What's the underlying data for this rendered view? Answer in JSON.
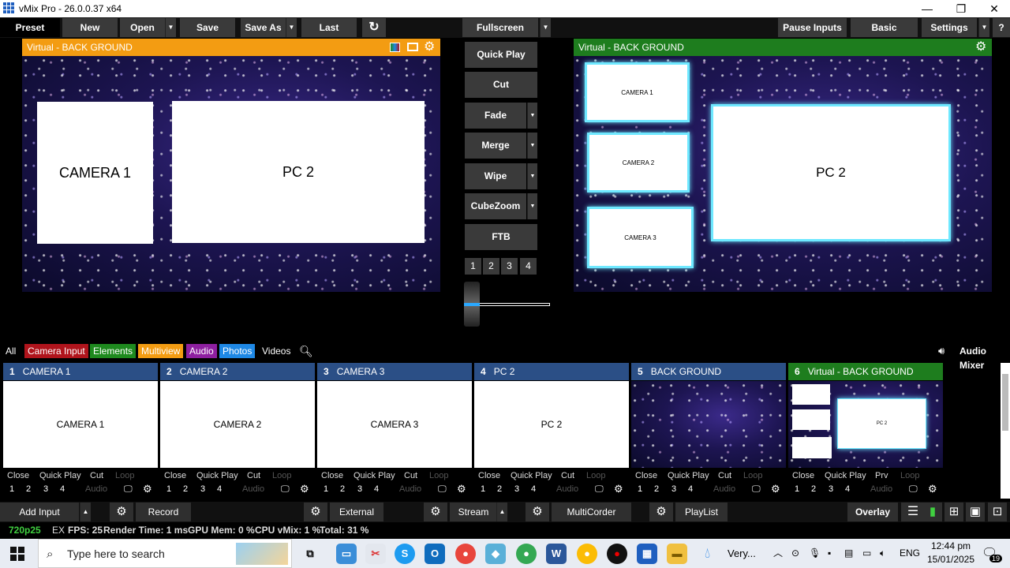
{
  "window": {
    "title": "vMix Pro - 26.0.0.37 x64",
    "minimize": "—",
    "maximize": "❐",
    "close": "✕"
  },
  "toolbar": {
    "preset": "Preset",
    "new": "New",
    "open": "Open",
    "save": "Save",
    "save_as": "Save As",
    "last": "Last",
    "refresh_icon": "refresh-icon",
    "fullscreen": "Fullscreen",
    "pause_inputs": "Pause Inputs",
    "basic": "Basic",
    "settings": "Settings",
    "help": "?"
  },
  "preview": {
    "title": "Virtual - BACK GROUND",
    "boxes": [
      "CAMERA 1",
      "PC 2"
    ],
    "header_color": "#f39c12"
  },
  "output": {
    "title": "Virtual - BACK GROUND",
    "boxes": [
      "CAMERA 1",
      "CAMERA 2",
      "CAMERA 3",
      "PC 2"
    ],
    "header_color": "#1e7d1e"
  },
  "transitions": {
    "quick_play": "Quick Play",
    "cut": "Cut",
    "fade": "Fade",
    "merge": "Merge",
    "wipe": "Wipe",
    "cubezoom": "CubeZoom",
    "ftb": "FTB",
    "numbers": [
      "1",
      "2",
      "3",
      "4"
    ]
  },
  "filters": {
    "all": "All",
    "camera_input": "Camera Input",
    "elements": "Elements",
    "multiview": "Multiview",
    "audio": "Audio",
    "photos": "Photos",
    "videos": "Videos",
    "audio_mixer": "Audio Mixer",
    "colors": {
      "camera_input": "#b0141c",
      "elements": "#1e8a1e",
      "multiview": "#f39c12",
      "audio": "#8e1fa0",
      "photos": "#1e88e5"
    }
  },
  "inputs": [
    {
      "num": "1",
      "name": "CAMERA 1",
      "thumb": "CAMERA 1",
      "cut": "Cut"
    },
    {
      "num": "2",
      "name": "CAMERA 2",
      "thumb": "CAMERA 2",
      "cut": "Cut"
    },
    {
      "num": "3",
      "name": "CAMERA 3",
      "thumb": "CAMERA 3",
      "cut": "Cut"
    },
    {
      "num": "4",
      "name": "PC 2",
      "thumb": "PC 2",
      "cut": "Cut"
    },
    {
      "num": "5",
      "name": "BACK GROUND",
      "thumb": "",
      "cut": "Cut"
    },
    {
      "num": "6",
      "name": "Virtual - BACK GROUND",
      "thumb": "PC 2",
      "cut": "Prv"
    }
  ],
  "tile_controls": {
    "close": "Close",
    "quick_play": "Quick Play",
    "loop": "Loop",
    "audio": "Audio",
    "nums": [
      "1",
      "2",
      "3",
      "4"
    ]
  },
  "bottom": {
    "add_input": "Add Input",
    "record": "Record",
    "external": "External",
    "stream": "Stream",
    "multicorder": "MultiCorder",
    "playlist": "PlayList",
    "overlay": "Overlay"
  },
  "status": {
    "format": "720p25",
    "ex": "EX",
    "fps": "FPS: 25",
    "render": "Render Time: 1 ms",
    "gpu": "GPU Mem: 0 %",
    "cpu": "CPU vMix: 1 %",
    "total": "Total: 31 %"
  },
  "taskbar": {
    "search_placeholder": "Type here to search",
    "weather": "Very...",
    "lang": "ENG",
    "time": "12:44 pm",
    "date": "15/01/2025",
    "notifications": "19"
  }
}
